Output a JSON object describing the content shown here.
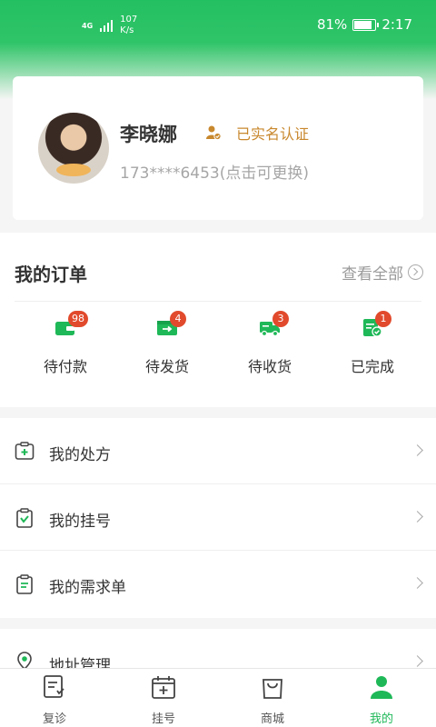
{
  "status_bar": {
    "network": "4G",
    "speed_value": "107",
    "speed_unit": "K/s",
    "battery": "81%",
    "time": "2:17"
  },
  "profile": {
    "name": "李晓娜",
    "verify_text": "已实名认证",
    "phone": "173****6453(点击可更换)"
  },
  "orders": {
    "title": "我的订单",
    "view_all": "查看全部",
    "items": [
      {
        "label": "待付款",
        "badge": "98"
      },
      {
        "label": "待发货",
        "badge": "4"
      },
      {
        "label": "待收货",
        "badge": "3"
      },
      {
        "label": "已完成",
        "badge": "1"
      }
    ]
  },
  "menu": {
    "items": [
      {
        "label": "我的处方"
      },
      {
        "label": "我的挂号"
      },
      {
        "label": "我的需求单"
      },
      {
        "label": "地址管理"
      }
    ]
  },
  "tabbar": {
    "tabs": [
      {
        "label": "复诊"
      },
      {
        "label": "挂号"
      },
      {
        "label": "商城"
      },
      {
        "label": "我的"
      }
    ]
  },
  "colors": {
    "brand_green": "#1fb858",
    "verify_orange": "#c8882e",
    "badge_red": "#e14a2c"
  }
}
